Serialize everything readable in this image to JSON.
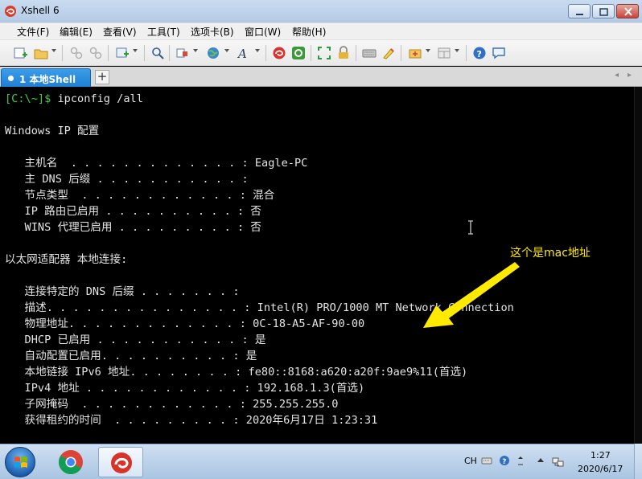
{
  "window": {
    "title": "Xshell 6",
    "controls": {
      "minimize": "minimize",
      "maximize": "maximize",
      "close": "close"
    }
  },
  "menu": [
    "文件(F)",
    "编辑(E)",
    "查看(V)",
    "工具(T)",
    "选项卡(B)",
    "窗口(W)",
    "帮助(H)"
  ],
  "toolbar": {
    "icons": [
      "new-session-icon",
      "open-folder-icon",
      "connect-icon",
      "disconnect-icon",
      "new-tab-icon",
      "find-icon",
      "transfer-icon",
      "globe-icon",
      "font-icon",
      "xshell-icon",
      "xftp-icon",
      "fullscreen-icon",
      "lock-icon",
      "keyboard-icon",
      "highlight-icon",
      "add-icon",
      "layout-icon",
      "help-icon",
      "chat-icon"
    ]
  },
  "tabs": {
    "active_label": "1 本地Shell",
    "add_label": "+",
    "nav_prev": "◂",
    "nav_next": "▸"
  },
  "terminal": {
    "prompt": "[C:\\~]$",
    "command": " ipconfig /all",
    "lines": [
      "",
      "Windows IP 配置",
      "",
      "   主机名  . . . . . . . . . . . . . : Eagle-PC",
      "   主 DNS 后缀 . . . . . . . . . . . :",
      "   节点类型  . . . . . . . . . . . . : 混合",
      "   IP 路由已启用 . . . . . . . . . . : 否",
      "   WINS 代理已启用 . . . . . . . . . : 否",
      "",
      "以太网适配器 本地连接:",
      "",
      "   连接特定的 DNS 后缀 . . . . . . . :",
      "   描述. . . . . . . . . . . . . . . : Intel(R) PRO/1000 MT Network Connection",
      "   物理地址. . . . . . . . . . . . . : 0C-18-A5-AF-90-00",
      "   DHCP 已启用 . . . . . . . . . . . : 是",
      "   自动配置已启用. . . . . . . . . . : 是",
      "   本地链接 IPv6 地址. . . . . . . . : fe80::8168:a620:a20f:9ae9%11(首选)",
      "   IPv4 地址 . . . . . . . . . . . . : 192.168.1.3(首选)",
      "   子网掩码  . . . . . . . . . . . . : 255.255.255.0",
      "   获得租约的时间  . . . . . . . . . : 2020年6月17日 1:23:31"
    ],
    "annotation": "这个是mac地址",
    "colors": {
      "background": "#000000",
      "text": "#e4e4e4",
      "prompt": "#35d235",
      "annotation": "#ffea00"
    }
  },
  "taskbar": {
    "apps": [
      "windows-start",
      "chrome",
      "xshell"
    ],
    "tray": {
      "ime": "CH",
      "clock_time": "1:27",
      "clock_date": "2020/6/17"
    }
  }
}
